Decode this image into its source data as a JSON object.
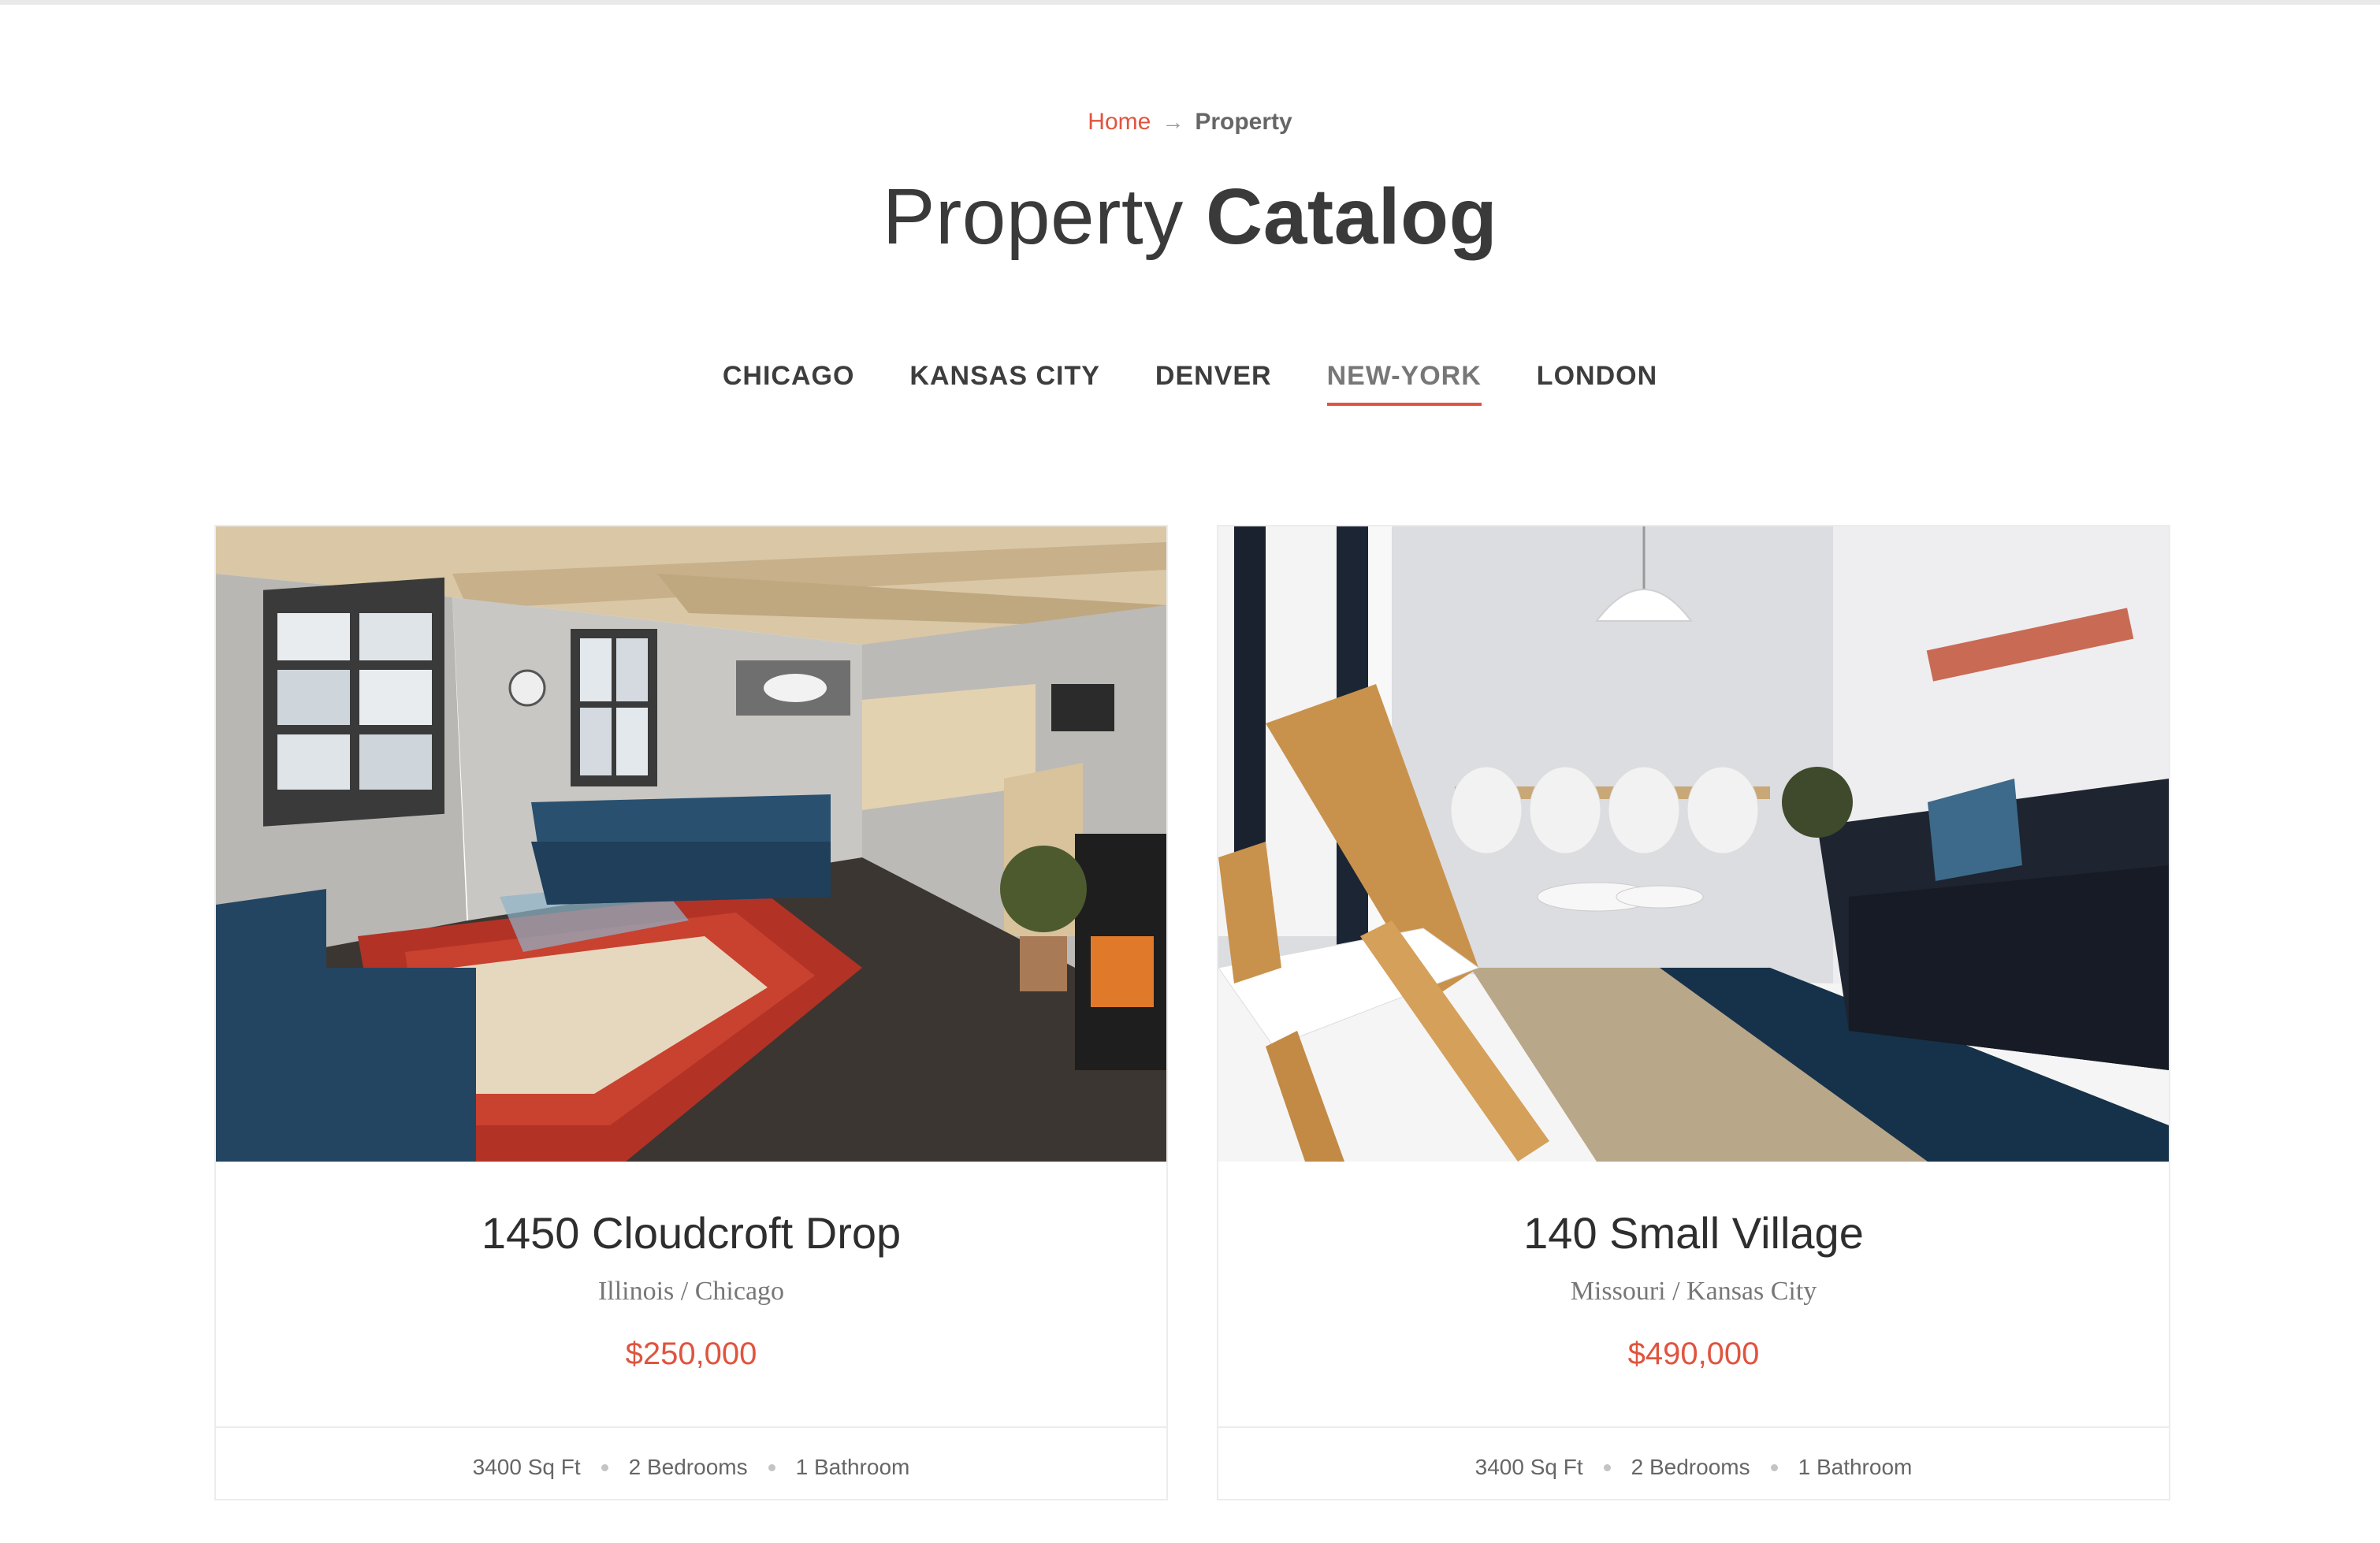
{
  "breadcrumb": {
    "home": "Home",
    "arrow": "→",
    "current": "Property"
  },
  "title": {
    "light": "Property",
    "bold": "Catalog"
  },
  "tabs": [
    {
      "label": "CHICAGO",
      "active": false
    },
    {
      "label": "KANSAS CITY",
      "active": false
    },
    {
      "label": "DENVER",
      "active": false
    },
    {
      "label": "NEW-YORK",
      "active": true
    },
    {
      "label": "LONDON",
      "active": false
    }
  ],
  "listings": [
    {
      "name": "1450 Cloudcroft Drop",
      "location": "Illinois / Chicago",
      "price": "$250,000",
      "area": "3400 Sq Ft",
      "bedrooms": "2 Bedrooms",
      "bathrooms": "1 Bathroom"
    },
    {
      "name": "140 Small Village",
      "location": "Missouri / Kansas City",
      "price": "$490,000",
      "area": "3400 Sq Ft",
      "bedrooms": "2 Bedrooms",
      "bathrooms": "1 Bathroom"
    }
  ],
  "colors": {
    "accent": "#e0543f",
    "text": "#333333",
    "muted": "#777777",
    "border": "#ececec"
  }
}
